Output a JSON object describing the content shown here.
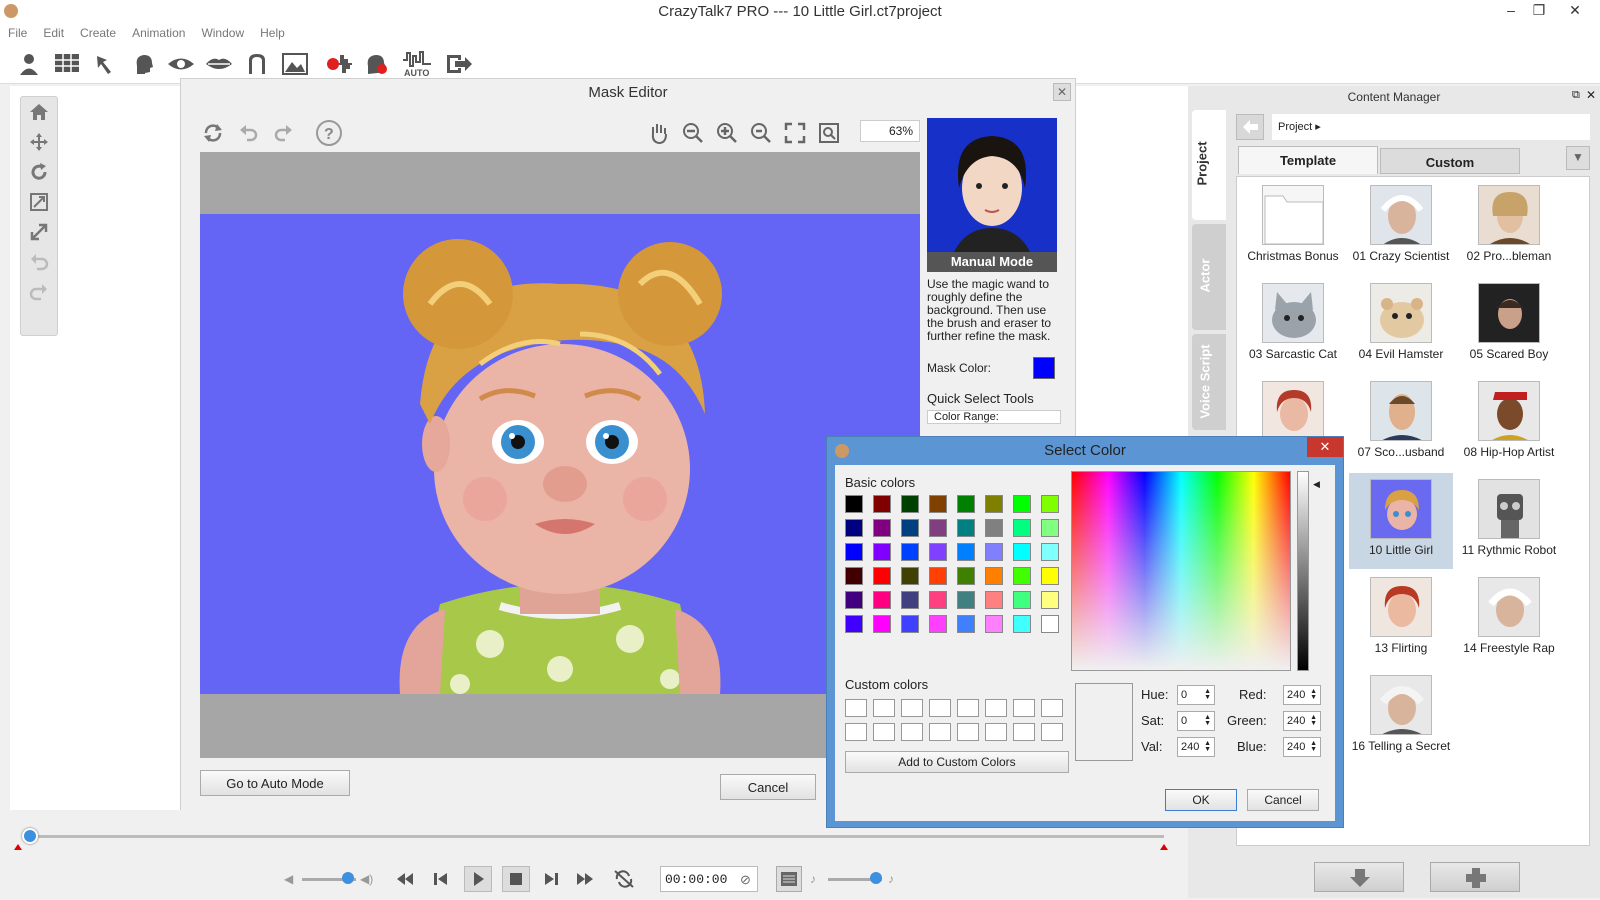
{
  "window": {
    "title": "CrazyTalk7 PRO --- 10 Little Girl.ct7project"
  },
  "menu": [
    "File",
    "Edit",
    "Create",
    "Animation",
    "Window",
    "Help"
  ],
  "toolbar": {
    "auto_label": "AUTO"
  },
  "mask_editor": {
    "title": "Mask Editor",
    "zoom": "63%",
    "mode_label": "Manual Mode",
    "description": "Use the magic wand to roughly define the background. Then use the brush and eraser to further refine the mask.",
    "mask_color_label": "Mask Color:",
    "mask_color": "#0000ff",
    "quick_select_label": "Quick Select Tools",
    "color_range_label": "Color Range:",
    "auto_mode_button": "Go to Auto Mode",
    "cancel_button": "Cancel",
    "background_color": "#6464f5"
  },
  "content_manager": {
    "title": "Content Manager",
    "side_tabs": [
      "Project",
      "Actor",
      "Voice Script"
    ],
    "path": "Project",
    "tabs": [
      "Template",
      "Custom"
    ],
    "items": [
      {
        "label": "Christmas Bonus",
        "icon": "folder-icon"
      },
      {
        "label": "01 Crazy Scientist",
        "icon": "scientist-icon"
      },
      {
        "label": "02 Pro...bleman",
        "icon": "nobleman-icon"
      },
      {
        "label": "03 Sarcastic Cat",
        "icon": "cat-icon"
      },
      {
        "label": "04 Evil Hamster",
        "icon": "hamster-icon"
      },
      {
        "label": "05 Scared Boy",
        "icon": "boy-icon"
      },
      {
        "label": "",
        "icon": "woman-icon"
      },
      {
        "label": "07 Sco...usband",
        "icon": "husband-icon"
      },
      {
        "label": "08 Hip-Hop Artist",
        "icon": "hiphop-icon"
      },
      {
        "label": "",
        "icon": "blank"
      },
      {
        "label": "10 Little Girl",
        "icon": "girl-icon"
      },
      {
        "label": "11 Rythmic Robot",
        "icon": "robot-icon"
      },
      {
        "label": "13 Flirting",
        "icon": "flirting-icon"
      },
      {
        "label": "14 Freestyle Rap",
        "icon": "rap-icon"
      },
      {
        "label": "",
        "icon": "blank"
      },
      {
        "label": "16 Telling a Secret",
        "icon": "secret-icon"
      }
    ],
    "selected_item": "10 Little Girl"
  },
  "timeline": {
    "time": "00:00:00"
  },
  "select_color": {
    "title": "Select Color",
    "basic_colors_label": "Basic colors",
    "custom_colors_label": "Custom colors",
    "basic_colors": [
      [
        "#000000",
        "#800000",
        "#004000",
        "#804000",
        "#008000",
        "#808000",
        "#00ff00",
        "#80ff00"
      ],
      [
        "#000080",
        "#800080",
        "#004080",
        "#804080",
        "#008080",
        "#808080",
        "#00ff80",
        "#80ff80"
      ],
      [
        "#0000ff",
        "#8000ff",
        "#0040ff",
        "#8040ff",
        "#0080ff",
        "#8080ff",
        "#00ffff",
        "#80ffff"
      ],
      [
        "#400000",
        "#ff0000",
        "#404000",
        "#ff4000",
        "#408000",
        "#ff8000",
        "#40ff00",
        "#ffff00"
      ],
      [
        "#400080",
        "#ff0080",
        "#404080",
        "#ff4080",
        "#408080",
        "#ff8080",
        "#40ff80",
        "#ffff80"
      ],
      [
        "#4000ff",
        "#ff00ff",
        "#4040ff",
        "#ff40ff",
        "#4080ff",
        "#ff80ff",
        "#40ffff",
        "#ffffff"
      ]
    ],
    "add_custom_button": "Add to Custom Colors",
    "hue_label": "Hue:",
    "hue": "0",
    "sat_label": "Sat:",
    "sat": "0",
    "val_label": "Val:",
    "val": "240",
    "red_label": "Red:",
    "red": "240",
    "green_label": "Green:",
    "green": "240",
    "blue_label": "Blue:",
    "blue": "240",
    "ok_button": "OK",
    "cancel_button": "Cancel"
  }
}
